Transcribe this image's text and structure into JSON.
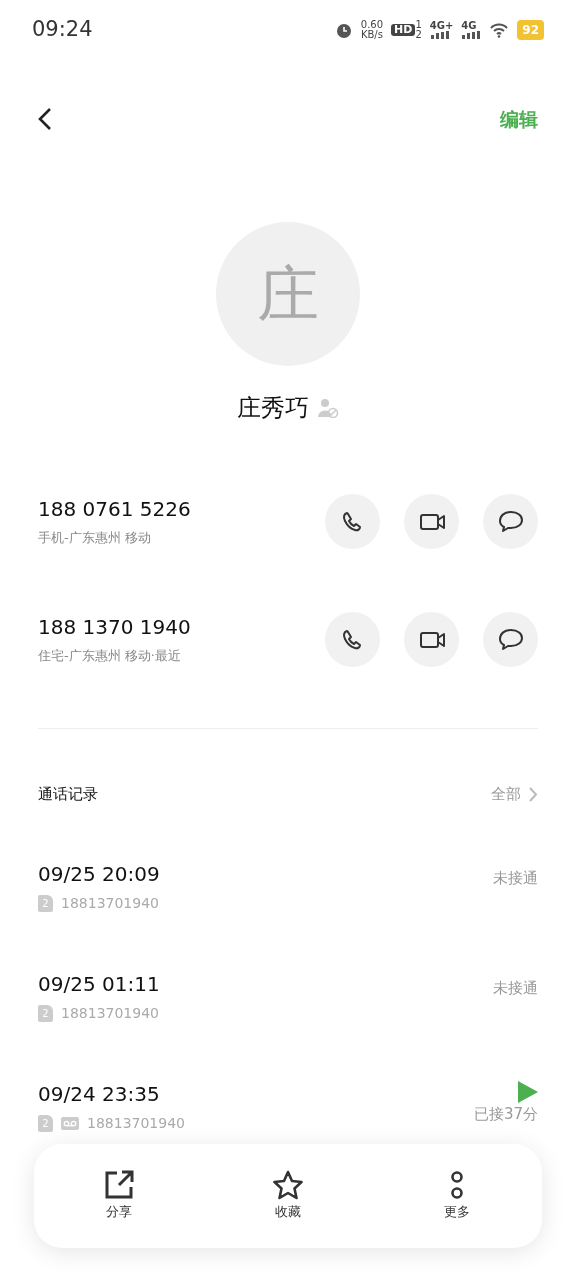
{
  "status_bar": {
    "time": "09:24",
    "speed": "0.60",
    "speed_unit": "KB/s",
    "hd": "HD",
    "hd_sup": "1",
    "hd_sub": "2",
    "signals": [
      "4G+",
      "4G"
    ],
    "battery": "92"
  },
  "header": {
    "edit": "编辑"
  },
  "contact": {
    "avatar": "庄",
    "name": "庄秀巧"
  },
  "phones": [
    {
      "number": "188 0761 5226",
      "detail": "手机-广东惠州 移动"
    },
    {
      "number": "188 1370 1940",
      "detail": "住宅-广东惠州 移动·最近"
    }
  ],
  "call_log": {
    "title": "通话记录",
    "all": "全部",
    "entries": [
      {
        "time": "09/25 20:09",
        "sim": "2",
        "number": "18813701940",
        "status": "未接通",
        "recording": false
      },
      {
        "time": "09/25 01:11",
        "sim": "2",
        "number": "18813701940",
        "status": "未接通",
        "recording": false
      },
      {
        "time": "09/24 23:35",
        "sim": "2",
        "number": "18813701940",
        "status": "已接37分",
        "recording": true
      }
    ]
  },
  "actions": [
    {
      "kind": "share",
      "label": "分享"
    },
    {
      "kind": "favorite",
      "label": "收藏"
    },
    {
      "kind": "more",
      "label": "更多"
    }
  ]
}
